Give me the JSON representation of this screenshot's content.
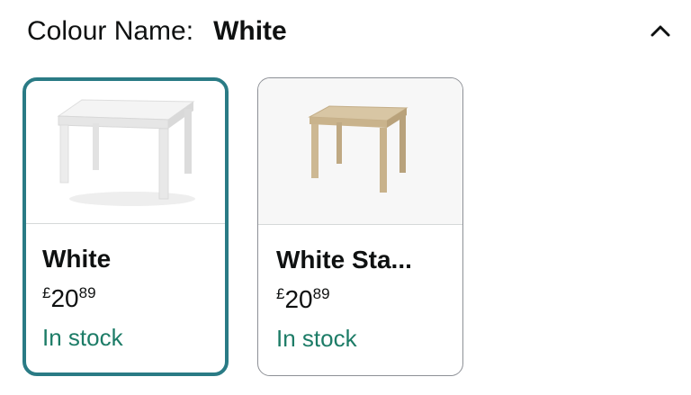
{
  "header": {
    "label": "Colour Name:",
    "selected_value": "White",
    "collapse_icon": "chevron-up-icon"
  },
  "options": [
    {
      "name": "White",
      "price_symbol": "£",
      "price_whole": "20",
      "price_fraction": "89",
      "availability": "In stock",
      "selected": true,
      "image": "white-side-table"
    },
    {
      "name": "White Sta...",
      "price_symbol": "£",
      "price_whole": "20",
      "price_fraction": "89",
      "availability": "In stock",
      "selected": false,
      "image": "oak-side-table"
    }
  ],
  "colors": {
    "selected_border": "#2a7b85",
    "in_stock": "#1d7c67"
  }
}
